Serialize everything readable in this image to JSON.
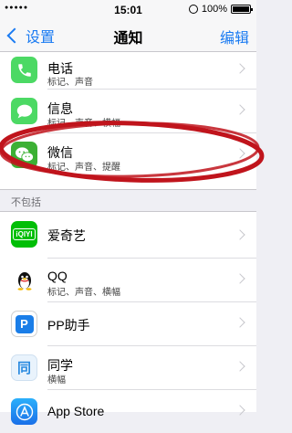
{
  "status_bar": {
    "signal": "●●●●●",
    "time": "15:01",
    "battery": "100%"
  },
  "nav": {
    "back_label": "设置",
    "title": "通知",
    "edit_label": "编辑"
  },
  "included": [
    {
      "name": "电话",
      "detail": "标记、声音",
      "icon": "phone-icon",
      "color": "#4cd964"
    },
    {
      "name": "信息",
      "detail": "标记、声音、横幅",
      "icon": "messages-icon",
      "color": "#4cd964"
    },
    {
      "name": "微信",
      "detail": "标记、声音、提醒",
      "icon": "wechat-icon",
      "color": "#3cb034"
    }
  ],
  "excluded_header": "不包括",
  "excluded": [
    {
      "name": "爱奇艺",
      "detail": "",
      "icon": "iqiyi-icon",
      "color": "#00be06",
      "icon_text": "iQIYI"
    },
    {
      "name": "QQ",
      "detail": "标记、声音、横幅",
      "icon": "qq-penguin-icon",
      "color": "#ffffff"
    },
    {
      "name": "PP助手",
      "detail": "",
      "icon": "pp-assistant-icon",
      "color": "#1b7ee8",
      "icon_text": "P"
    },
    {
      "name": "同学",
      "detail": "横幅",
      "icon": "tongxue-icon",
      "color": "#2a8be0",
      "icon_text": "同"
    },
    {
      "name": "App Store",
      "detail": "",
      "icon": "app-store-icon",
      "color": "#1a8df5",
      "icon_text": "A"
    }
  ],
  "annotation_color": "#c0141c"
}
